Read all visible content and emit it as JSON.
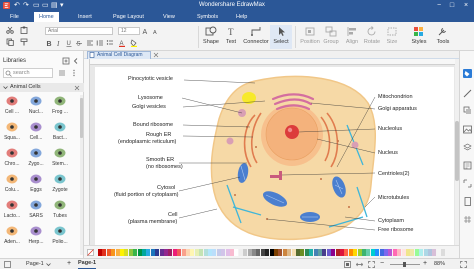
{
  "app": {
    "title": "Wondershare EdrawMax",
    "window_controls": [
      "−",
      "□",
      "×"
    ]
  },
  "quick_access": [
    "↶",
    "↷",
    "▭",
    "▭",
    "▤",
    "▾"
  ],
  "menu": {
    "tabs": [
      "File",
      "Home",
      "Insert",
      "Page Layout",
      "View",
      "Symbols",
      "Help"
    ],
    "active": "Home"
  },
  "ribbon": {
    "font_name": "Arial",
    "font_size": "12",
    "tools": [
      {
        "label": "Shape",
        "enabled": true
      },
      {
        "label": "Text",
        "enabled": true
      },
      {
        "label": "Connector",
        "enabled": true
      },
      {
        "label": "Select",
        "enabled": true
      },
      {
        "label": "Position",
        "enabled": false
      },
      {
        "label": "Group",
        "enabled": false
      },
      {
        "label": "Align",
        "enabled": false
      },
      {
        "label": "Rotate",
        "enabled": false
      },
      {
        "label": "Size",
        "enabled": false
      }
    ],
    "right_tools": [
      "Styles",
      "Tools"
    ]
  },
  "document": {
    "tab_title": "Animal Cell Diagram",
    "page_name": "Page-1",
    "page_tab": "Page-1"
  },
  "library": {
    "title": "Libraries",
    "search_placeholder": "search",
    "category": "Animal Cells",
    "shapes": [
      "Cell ...",
      "Nucl...",
      "Frog ...",
      "Squa...",
      "Cell...",
      "Bact...",
      "Chro...",
      "Zygo...",
      "Stem...",
      "Colu...",
      "Eggs",
      "Zygote",
      "Lacto...",
      "SARS",
      "Tubes",
      "Aden...",
      "Herp...",
      "Polio..."
    ]
  },
  "diagram": {
    "left_labels": [
      "Pinocytotic vesicle",
      "Lysosome",
      "Golgi vesicles",
      "Bound ribosome",
      "Rough ER",
      "(endoplasmic reticulum)",
      "Smooth ER",
      "(no ribosomes)",
      "Cytosol",
      "(fluid portion of cytoplasm)",
      "Cell",
      "(plasma membrane)"
    ],
    "right_labels": [
      "Mitochondrion",
      "Golgi apparatus",
      "Nucleolus",
      "Nucleus",
      "Centrioles(2)",
      "Microtubules",
      "Cytoplasm",
      "Free ribosome"
    ]
  },
  "status": {
    "zoom": "88%"
  },
  "colors": {
    "brand": "#2b5797",
    "cell_body": "#f6d9a6",
    "nucleus": "#f4b27c",
    "nucleolus": "#dc3b3b",
    "mitochondria": "#4b7fcf",
    "golgi": "#d46f9f",
    "microtubule": "#3fb6d9"
  },
  "palette": [
    "#c00000",
    "#e0301e",
    "#f05a28",
    "#f7941d",
    "#fbb040",
    "#fff200",
    "#d7df23",
    "#8dc63f",
    "#39b54a",
    "#009444",
    "#00a79d",
    "#27aae1",
    "#1c75bc",
    "#2b3990",
    "#662d91",
    "#92278f",
    "#9e1f63",
    "#ed1e79",
    "#f15a5a",
    "#f9a08c",
    "#fdd5b1",
    "#fff6b3",
    "#e6f0b4",
    "#c4e3b4",
    "#b2dfdb",
    "#b3e5fc",
    "#bbdefb",
    "#c5cae9",
    "#d1c4e9",
    "#e1bee7",
    "#f8bbd0",
    "#ffffff",
    "#eeeeee",
    "#cccccc",
    "#aaaaaa",
    "#888888",
    "#666666",
    "#444444",
    "#222222",
    "#000000",
    "#7b3f00",
    "#a0522d",
    "#cd853f",
    "#deb887",
    "#f5deb3",
    "#556b2f",
    "#6b8e23",
    "#2e8b57",
    "#20b2aa",
    "#4682b4",
    "#5f9ea0",
    "#483d8b",
    "#6a5acd",
    "#8b008b",
    "#b22222",
    "#dc143c",
    "#ff6347",
    "#ff8c00",
    "#ffd700",
    "#9acd32",
    "#3cb371",
    "#66cdaa",
    "#00ced1",
    "#1e90ff",
    "#4169e1",
    "#7b68ee",
    "#ba55d3",
    "#ff69b4",
    "#ffb6c1",
    "#ffe4e1",
    "#f0e68c",
    "#eee8aa",
    "#98fb98",
    "#afeeee",
    "#add8e6",
    "#b0c4de",
    "#d8bfd8",
    "#f5f5f5",
    "#dcdcdc"
  ]
}
